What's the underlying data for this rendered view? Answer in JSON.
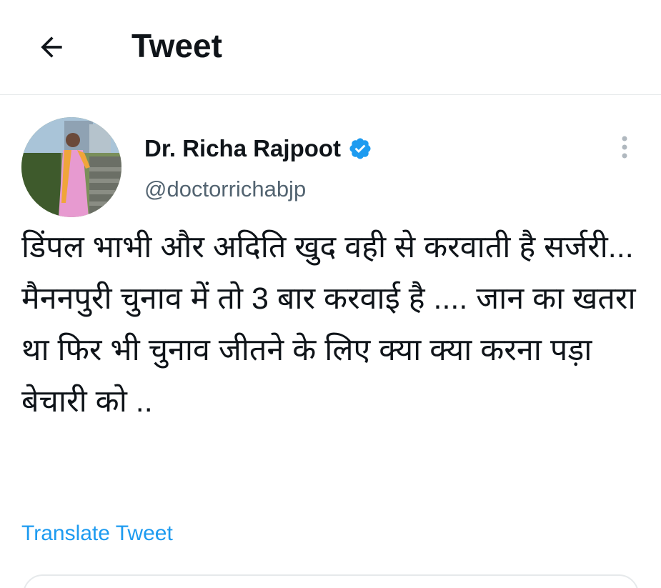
{
  "header": {
    "title": "Tweet",
    "back_icon": "arrow-left-icon"
  },
  "tweet": {
    "author": {
      "display_name": "Dr. Richa Rajpoot",
      "handle": "@doctorrichabjp",
      "verified": true,
      "verified_icon": "verified-badge-icon",
      "avatar_icon": "profile-photo"
    },
    "more_icon": "more-vertical-icon",
    "text": "डिंपल भाभी और अदिति खुद वही से करवाती है सर्जरी... मैननपुरी चुनाव में तो 3 बार करवाई है .... जान का खतरा था फिर भी चुनाव जीतने के लिए क्या क्या करना पड़ा बेचारी को ..",
    "translate_label": "Translate Tweet"
  },
  "colors": {
    "accent": "#1d9bf0",
    "text_primary": "#0f1419",
    "text_secondary": "#536471",
    "border": "#e6e9eb"
  }
}
